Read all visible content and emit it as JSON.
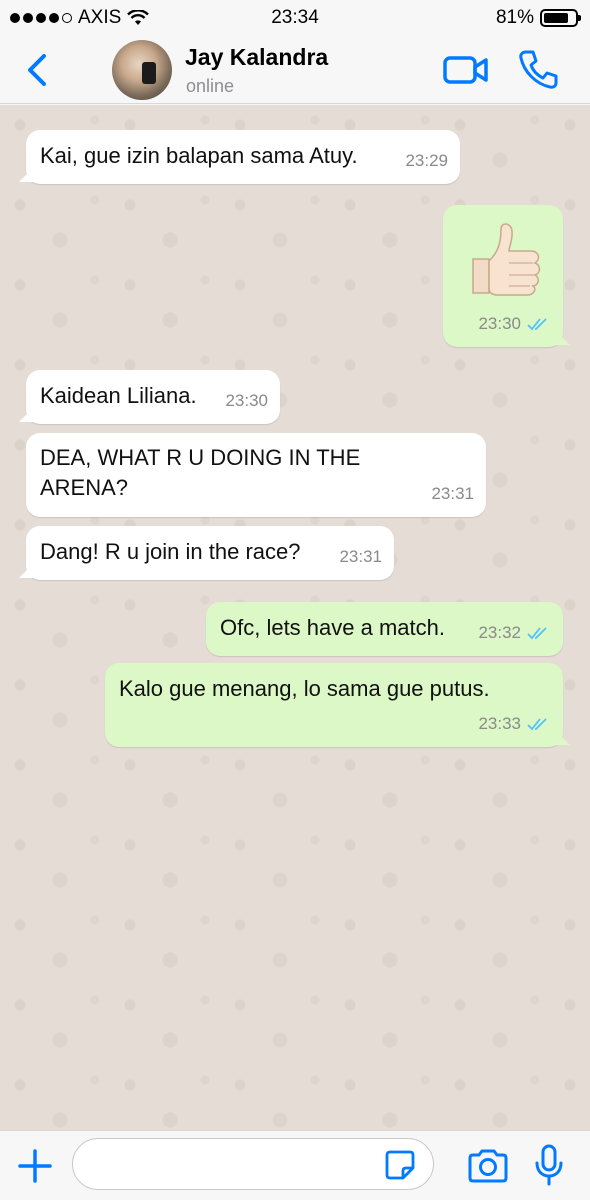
{
  "status_bar": {
    "carrier": "AXIS",
    "time": "23:34",
    "battery": "81%",
    "battery_level": 0.81,
    "signal_bars": 4
  },
  "header": {
    "contact_name": "Jay Kalandra",
    "contact_status": "online",
    "accent_color": "#007aff"
  },
  "messages": [
    {
      "direction": "incoming",
      "text": "Kai, gue izin balapan sama Atuy.",
      "time": "23:29"
    },
    {
      "direction": "outgoing",
      "text": "👍🏻",
      "emoji": "thumbs-up",
      "time": "23:30",
      "read": true
    },
    {
      "direction": "incoming",
      "text": "Kaidean Liliana.",
      "time": "23:30"
    },
    {
      "direction": "incoming",
      "text": "DEA, WHAT R U DOING IN THE ARENA?",
      "time": "23:31"
    },
    {
      "direction": "incoming",
      "text": "Dang! R u join in the race?",
      "time": "23:31"
    },
    {
      "direction": "outgoing",
      "text": "Ofc, lets have a match.",
      "time": "23:32",
      "read": true
    },
    {
      "direction": "outgoing",
      "text": "Kalo gue menang, lo sama gue putus.",
      "time": "23:33",
      "read": true
    }
  ],
  "input_bar": {
    "message_value": "",
    "placeholder": ""
  },
  "colors": {
    "incoming_bubble": "#ffffff",
    "outgoing_bubble": "#dcf8c6",
    "chat_background": "#e5ddd5",
    "read_ticks": "#4fc3f7"
  }
}
